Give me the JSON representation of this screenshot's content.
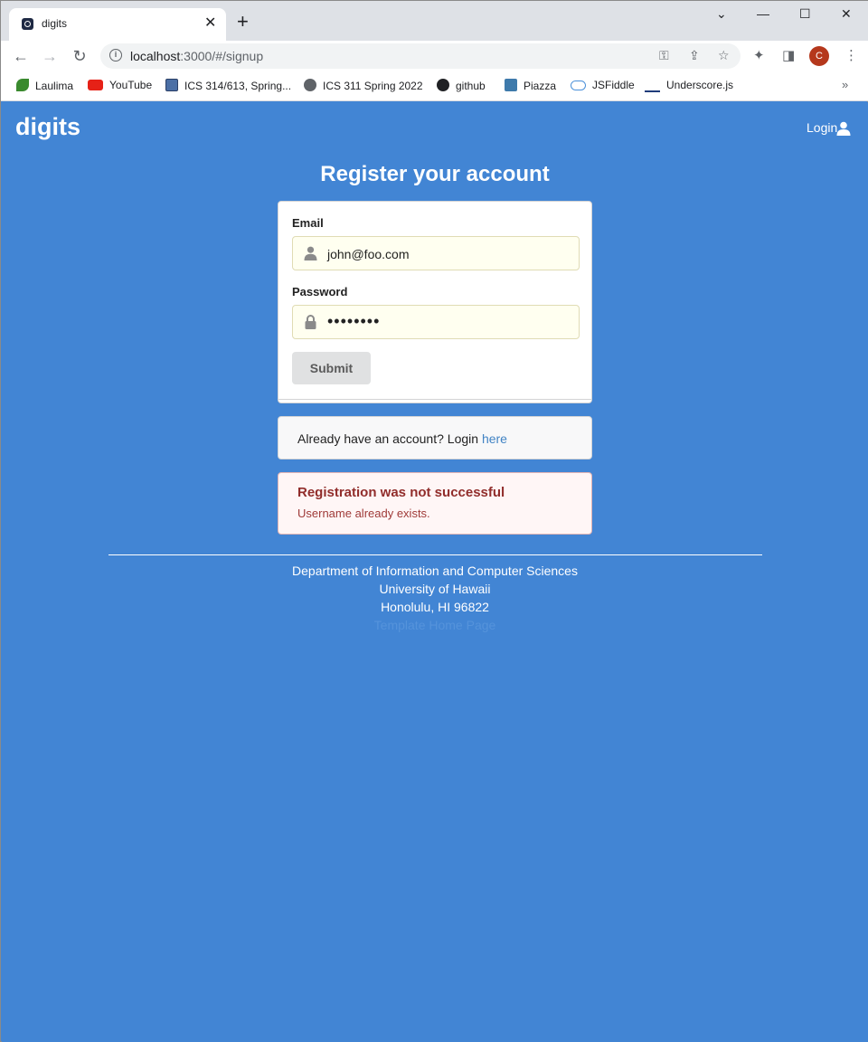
{
  "browser": {
    "tab_title": "digits",
    "tab_close": "✕",
    "new_tab": "+",
    "url_host": "localhost",
    "url_rest": ":3000/#/signup",
    "profile_initial": "C",
    "window_controls": [
      "⌄",
      "—",
      "☐",
      "✕"
    ],
    "bookmarks": [
      {
        "label": "Laulima",
        "color": "#3a8a2e"
      },
      {
        "label": "YouTube",
        "color": "#e62117"
      },
      {
        "label": "ICS 314/613, Spring...",
        "color": "#4b6fa5"
      },
      {
        "label": "ICS 311 Spring 2022",
        "color": "#5f6368"
      },
      {
        "label": "github",
        "color": "#202124"
      },
      {
        "label": "Piazza",
        "color": "#3e7aab"
      },
      {
        "label": "JSFiddle",
        "color": "#4a90d9"
      },
      {
        "label": "Underscore.js",
        "color": "#1f3c7a"
      }
    ],
    "bookmarks_more": "»"
  },
  "navbar": {
    "brand": "digits",
    "login": "Login"
  },
  "signup": {
    "title": "Register your account",
    "email_label": "Email",
    "email_value": "john@foo.com",
    "password_label": "Password",
    "password_value": "••••••••",
    "submit_label": "Submit",
    "login_prompt": "Already have an account? Login ",
    "login_link": "here"
  },
  "error": {
    "header": "Registration was not successful",
    "message": "Username already exists."
  },
  "footer": {
    "line1": "Department of Information and Computer Sciences",
    "line2": "University of Hawaii",
    "line3": "Honolulu, HI 96822",
    "line4": "Template Home Page"
  },
  "colors": {
    "background": "#4285d4",
    "error_text": "#912d2b",
    "link": "#4183c4"
  }
}
